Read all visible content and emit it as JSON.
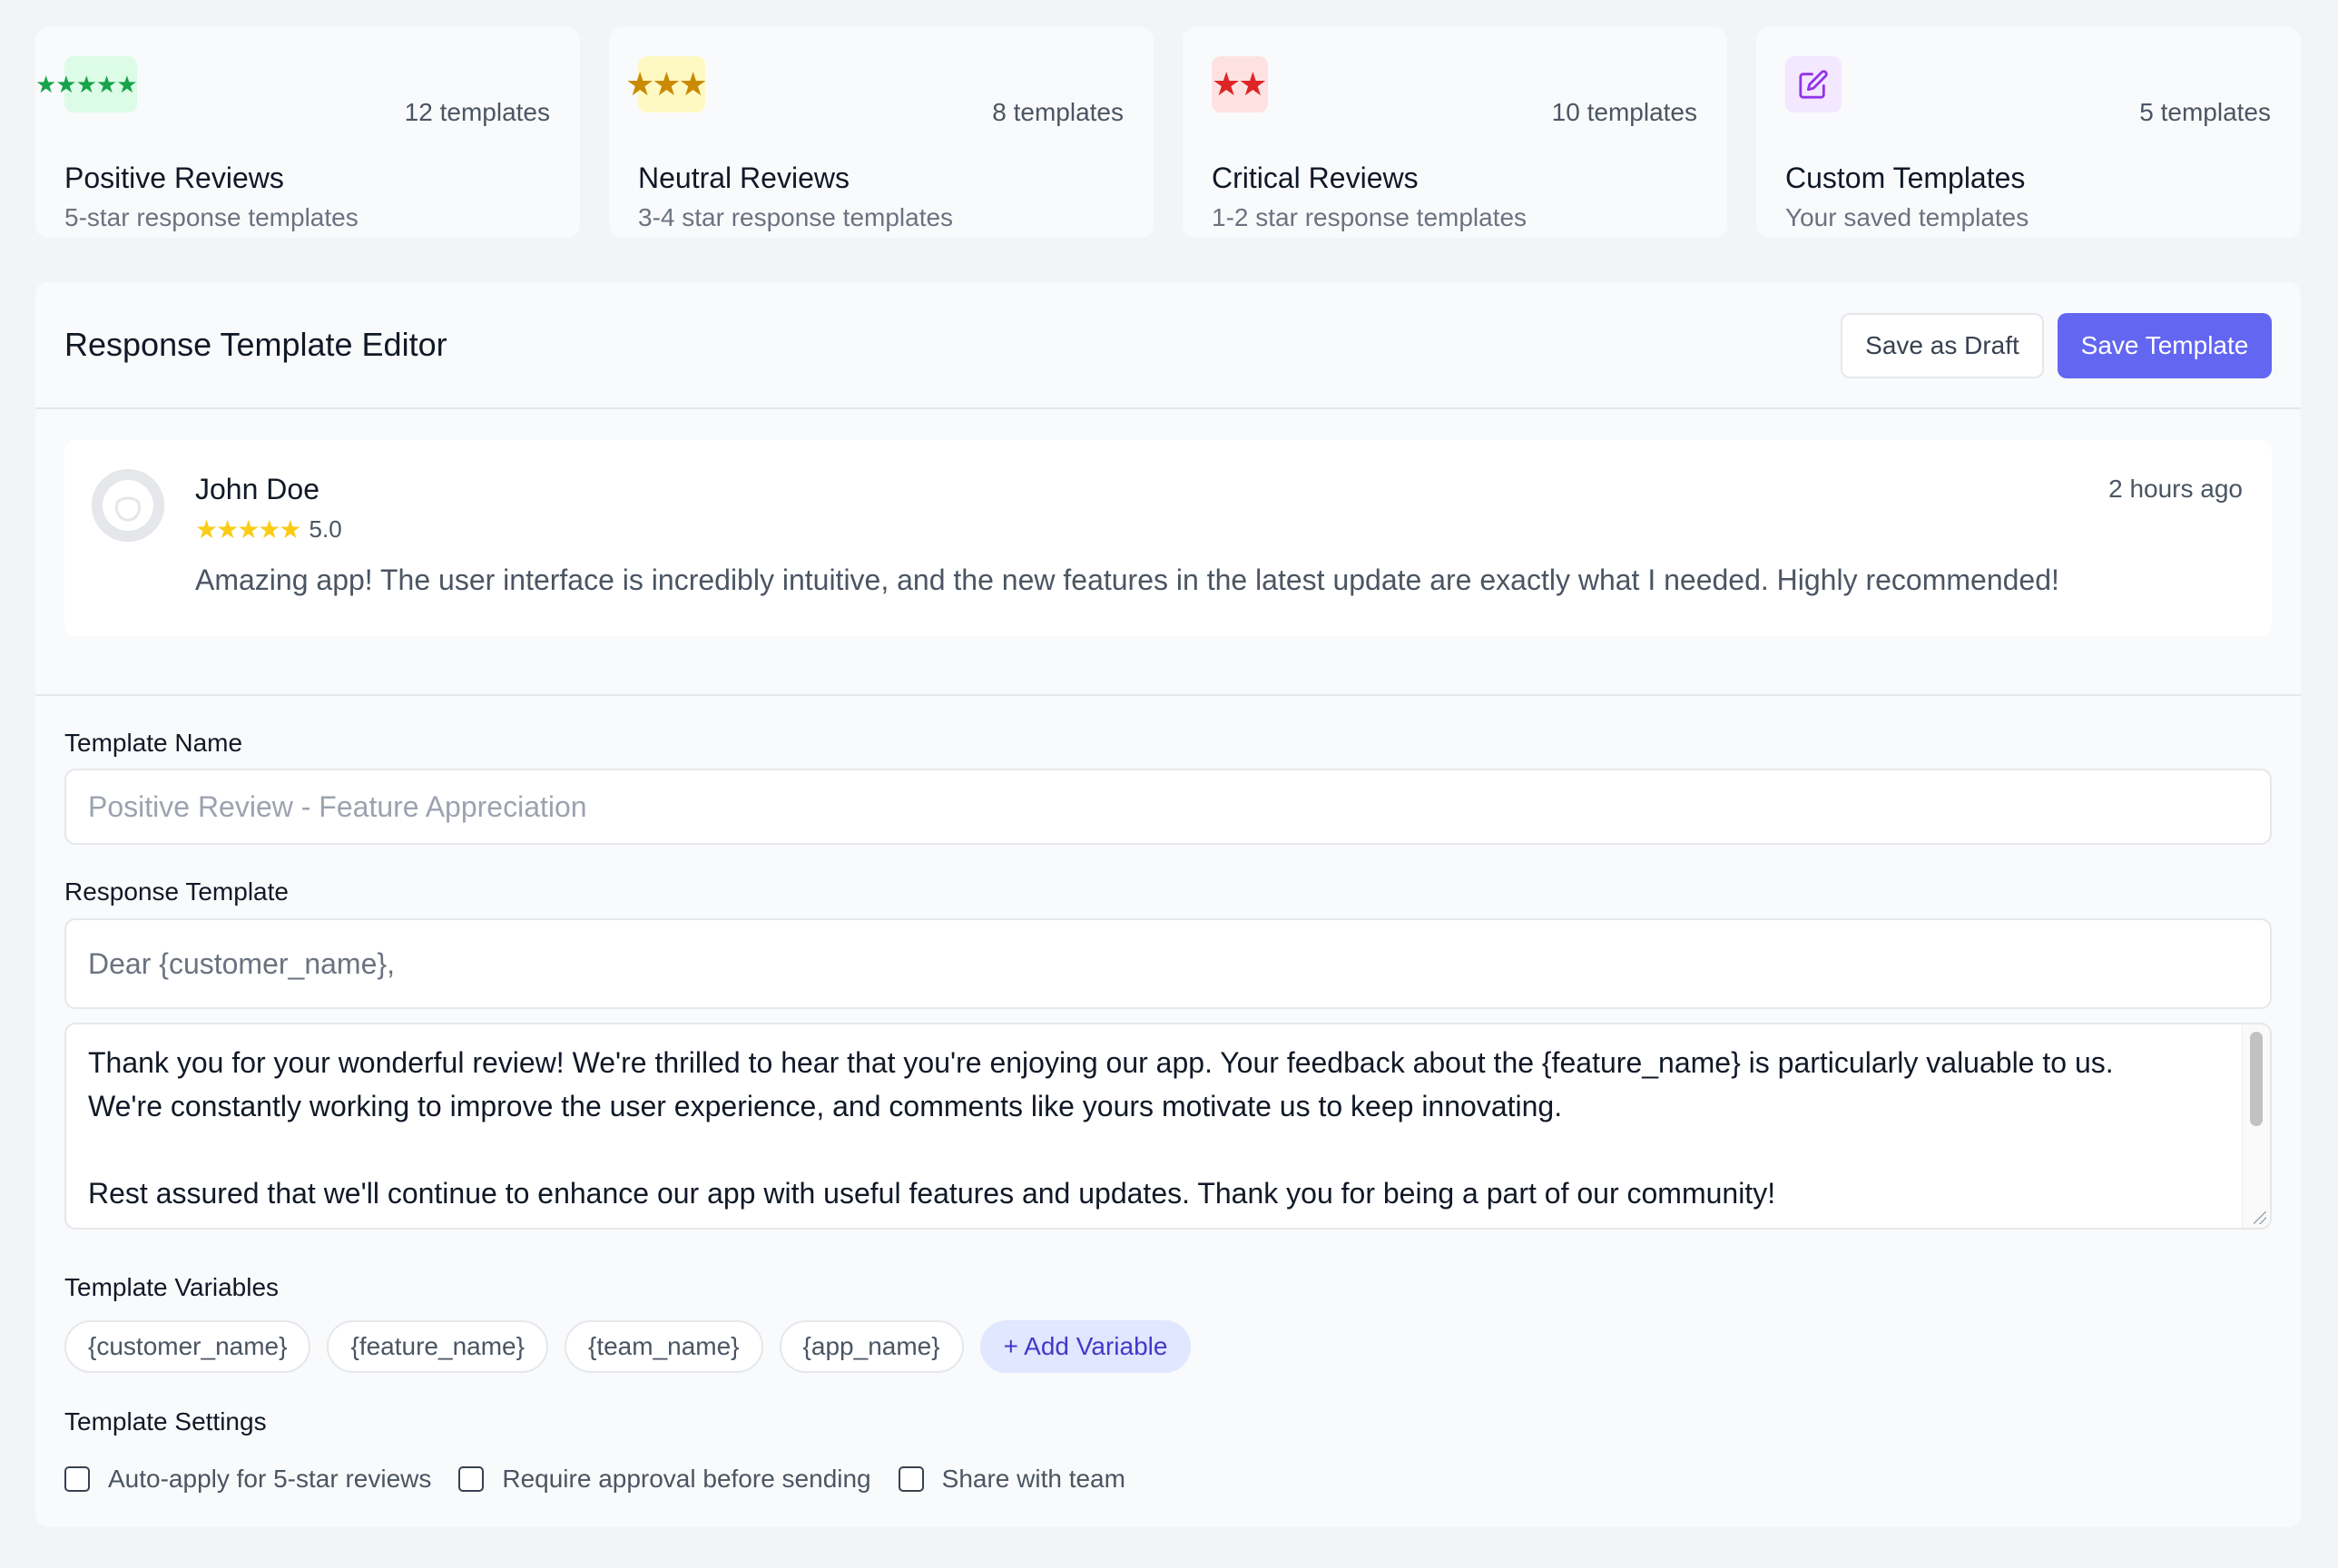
{
  "categories": [
    {
      "icon": "five-stars-icon",
      "stars": "★★★★★",
      "count": "12 templates",
      "title": "Positive Reviews",
      "subtitle": "5-star response templates",
      "color": "#16a34a"
    },
    {
      "icon": "three-stars-icon",
      "stars": "★★★",
      "count": "8 templates",
      "title": "Neutral Reviews",
      "subtitle": "3-4 star response templates",
      "color": "#ca8a04"
    },
    {
      "icon": "two-stars-icon",
      "stars": "★★",
      "count": "10 templates",
      "title": "Critical Reviews",
      "subtitle": "1-2 star response templates",
      "color": "#dc2626"
    },
    {
      "icon": "edit-icon",
      "count": "5 templates",
      "title": "Custom Templates",
      "subtitle": "Your saved templates",
      "color": "#9333ea"
    }
  ],
  "editor": {
    "title": "Response Template Editor",
    "save_draft_label": "Save as Draft",
    "save_template_label": "Save Template",
    "accent": "#6366f1"
  },
  "review": {
    "name": "John Doe",
    "stars": "★★★★★",
    "rating": "5.0",
    "time": "2 hours ago",
    "text": "Amazing app! The user interface is incredibly intuitive, and the new features in the latest update are exactly what I needed. Highly recommended!"
  },
  "form": {
    "template_name_label": "Template Name",
    "template_name_placeholder": "Positive Review - Feature Appreciation",
    "response_template_label": "Response Template",
    "greeting_placeholder": "Dear {customer_name},",
    "body_paragraph_1_line_1": "Thank you for your wonderful review! We're thrilled to hear that you're enjoying our app. Your feedback about the {feature_name} is particularly valuable to us.",
    "body_paragraph_1_line_2": "We're constantly working to improve the user experience, and comments like yours motivate us to keep innovating.",
    "body_paragraph_2": "Rest assured that we'll continue to enhance our app with useful features and updates. Thank you for being a part of our community!",
    "variables_label": "Template Variables",
    "variables": [
      "{customer_name}",
      "{feature_name}",
      "{team_name}",
      "{app_name}"
    ],
    "add_variable_label": "+ Add Variable",
    "settings_label": "Template Settings",
    "settings": [
      {
        "label": "Auto-apply for 5-star reviews",
        "checked": false
      },
      {
        "label": "Require approval before sending",
        "checked": false
      },
      {
        "label": "Share with team",
        "checked": false
      }
    ]
  }
}
